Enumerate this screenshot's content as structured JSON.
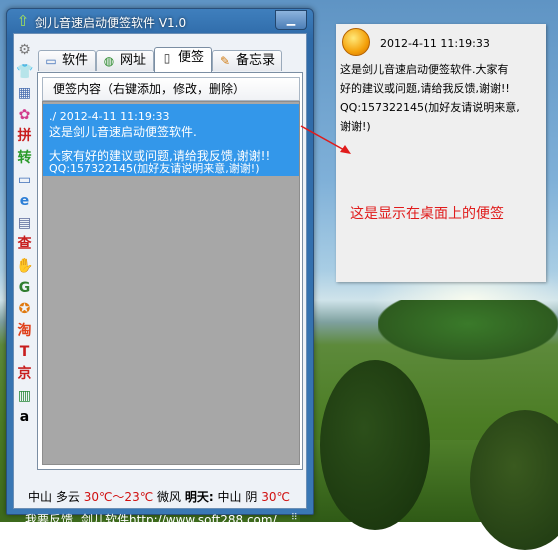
{
  "window": {
    "title": "剑儿音速启动便签软件 V1.0",
    "minimize_glyph": "▁"
  },
  "tabs": [
    {
      "label": "软件",
      "icon": "monitor-icon"
    },
    {
      "label": "网址",
      "icon": "globe-icon"
    },
    {
      "label": "便签",
      "icon": "note-icon",
      "active": true
    },
    {
      "label": "备忘录",
      "icon": "pencil-icon"
    }
  ],
  "panel": {
    "header": "便签内容（右键添加，修改，删除）",
    "notes": [
      {
        "line1": "./   2012-4-11 11:19:33",
        "line2": "这是剑儿音速启动便签软件.",
        "line3": "大家有好的建议或问题,请给我反馈,谢谢!!",
        "line4": "QQ:157322145(加好友请说明来意,谢谢!)"
      }
    ]
  },
  "toolbar": {
    "icons": [
      {
        "name": "gear-icon",
        "glyph": "⚙",
        "color": "#7a7a7a"
      },
      {
        "name": "shirt-icon",
        "glyph": "👕",
        "color": "#1f78c8"
      },
      {
        "name": "computer-settings-icon",
        "glyph": "▦",
        "color": "#4a6fb0"
      },
      {
        "name": "palette-icon",
        "glyph": "✿",
        "color": "#d23c8c"
      },
      {
        "name": "pinyin-icon",
        "glyph": "拼",
        "color": "#c81e1e"
      },
      {
        "name": "convert-icon",
        "glyph": "转",
        "color": "#2a9a2a"
      },
      {
        "name": "monitor-icon",
        "glyph": "▭",
        "color": "#3f6fb8"
      },
      {
        "name": "ie-icon",
        "glyph": "e",
        "color": "#2d7fd6"
      },
      {
        "name": "calculator-icon",
        "glyph": "▤",
        "color": "#5a6a9a"
      },
      {
        "name": "search-cha-icon",
        "glyph": "查",
        "color": "#c81e1e"
      },
      {
        "name": "baidu-paw-icon",
        "glyph": "✋",
        "color": "#2b4fc7"
      },
      {
        "name": "google-icon",
        "glyph": "G",
        "color": "#2f7d2f"
      },
      {
        "name": "fox-icon",
        "glyph": "✪",
        "color": "#e07a10"
      },
      {
        "name": "taobao-icon",
        "glyph": "淘",
        "color": "#e0401a"
      },
      {
        "name": "tmall-icon",
        "glyph": "T",
        "color": "#c81e1e"
      },
      {
        "name": "jingdong-icon",
        "glyph": "京",
        "color": "#c81e1e"
      },
      {
        "name": "book-icon",
        "glyph": "▥",
        "color": "#2a8a3a"
      },
      {
        "name": "amazon-icon",
        "glyph": "a",
        "color": "#000000"
      }
    ]
  },
  "weather": {
    "city": "中山",
    "condition": "多云",
    "temp": "30℃～23℃",
    "wind": "微风",
    "tomorrow_label": "明天:",
    "tomorrow_city": "中山",
    "tomorrow_condition": "阴",
    "tomorrow_temp": "30℃"
  },
  "footer": {
    "feedback_link": "我要反馈",
    "site_link": "剑儿软件http://www.soft288.com/"
  },
  "sticky": {
    "time": "2012-4-11 11:19:33",
    "line1": "这是剑儿音速启动便签软件.大家有",
    "line2": "好的建议或问题,请给我反馈,谢谢!!",
    "line3": "QQ:157322145(加好友请说明来意,",
    "line4": "谢谢!)",
    "caption": "这是显示在桌面上的便签"
  },
  "colors": {
    "accent_red": "#e01b1b",
    "note_selected": "#3397ea",
    "titlebar": "#3f7fbd"
  }
}
